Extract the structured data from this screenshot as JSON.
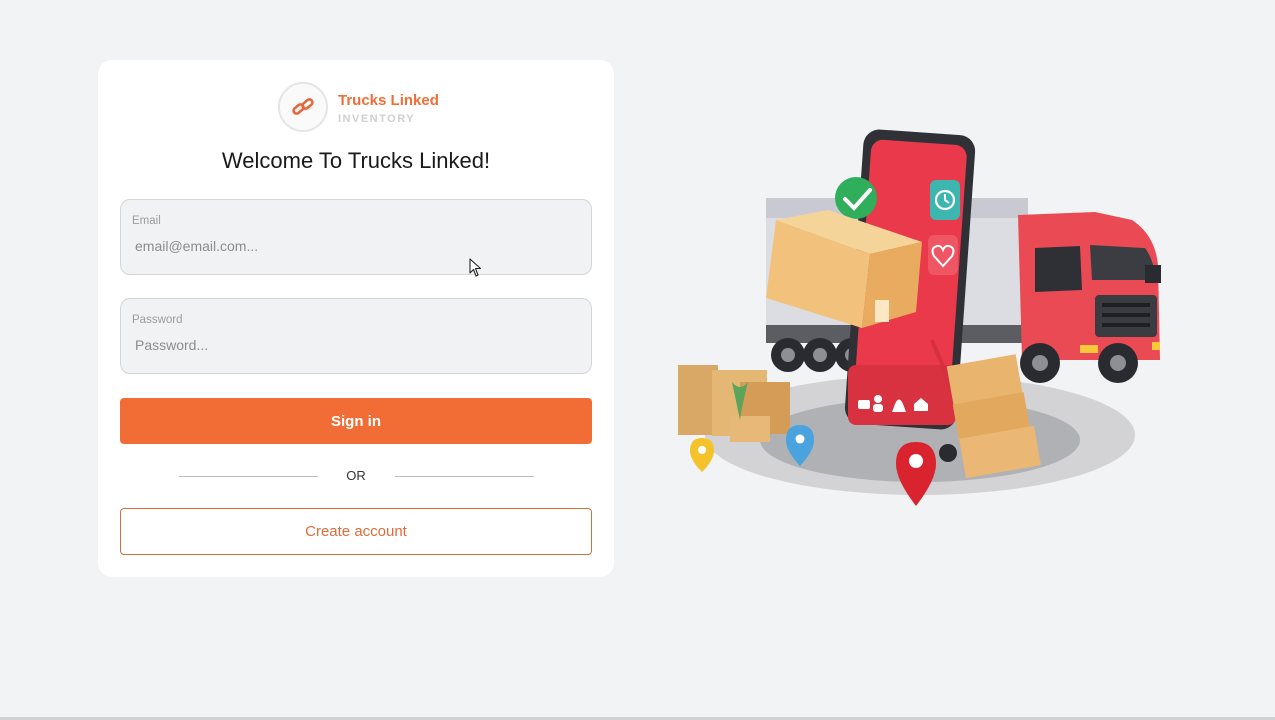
{
  "brand": {
    "name": "Trucks Linked",
    "subtitle": "INVENTORY",
    "accent_color": "#f26d36"
  },
  "login": {
    "title": "Welcome To Trucks Linked!",
    "email": {
      "label": "Email",
      "placeholder": "email@email.com...",
      "value": ""
    },
    "password": {
      "label": "Password",
      "placeholder": "Password...",
      "value": ""
    },
    "signin_label": "Sign in",
    "divider_label": "OR",
    "create_label": "Create account"
  },
  "hero": {
    "icons": [
      "truck-icon",
      "smartphone-icon",
      "package-icon",
      "check-icon",
      "clock-icon",
      "heart-icon",
      "map-pin-icon",
      "hand-truck-icon"
    ]
  }
}
